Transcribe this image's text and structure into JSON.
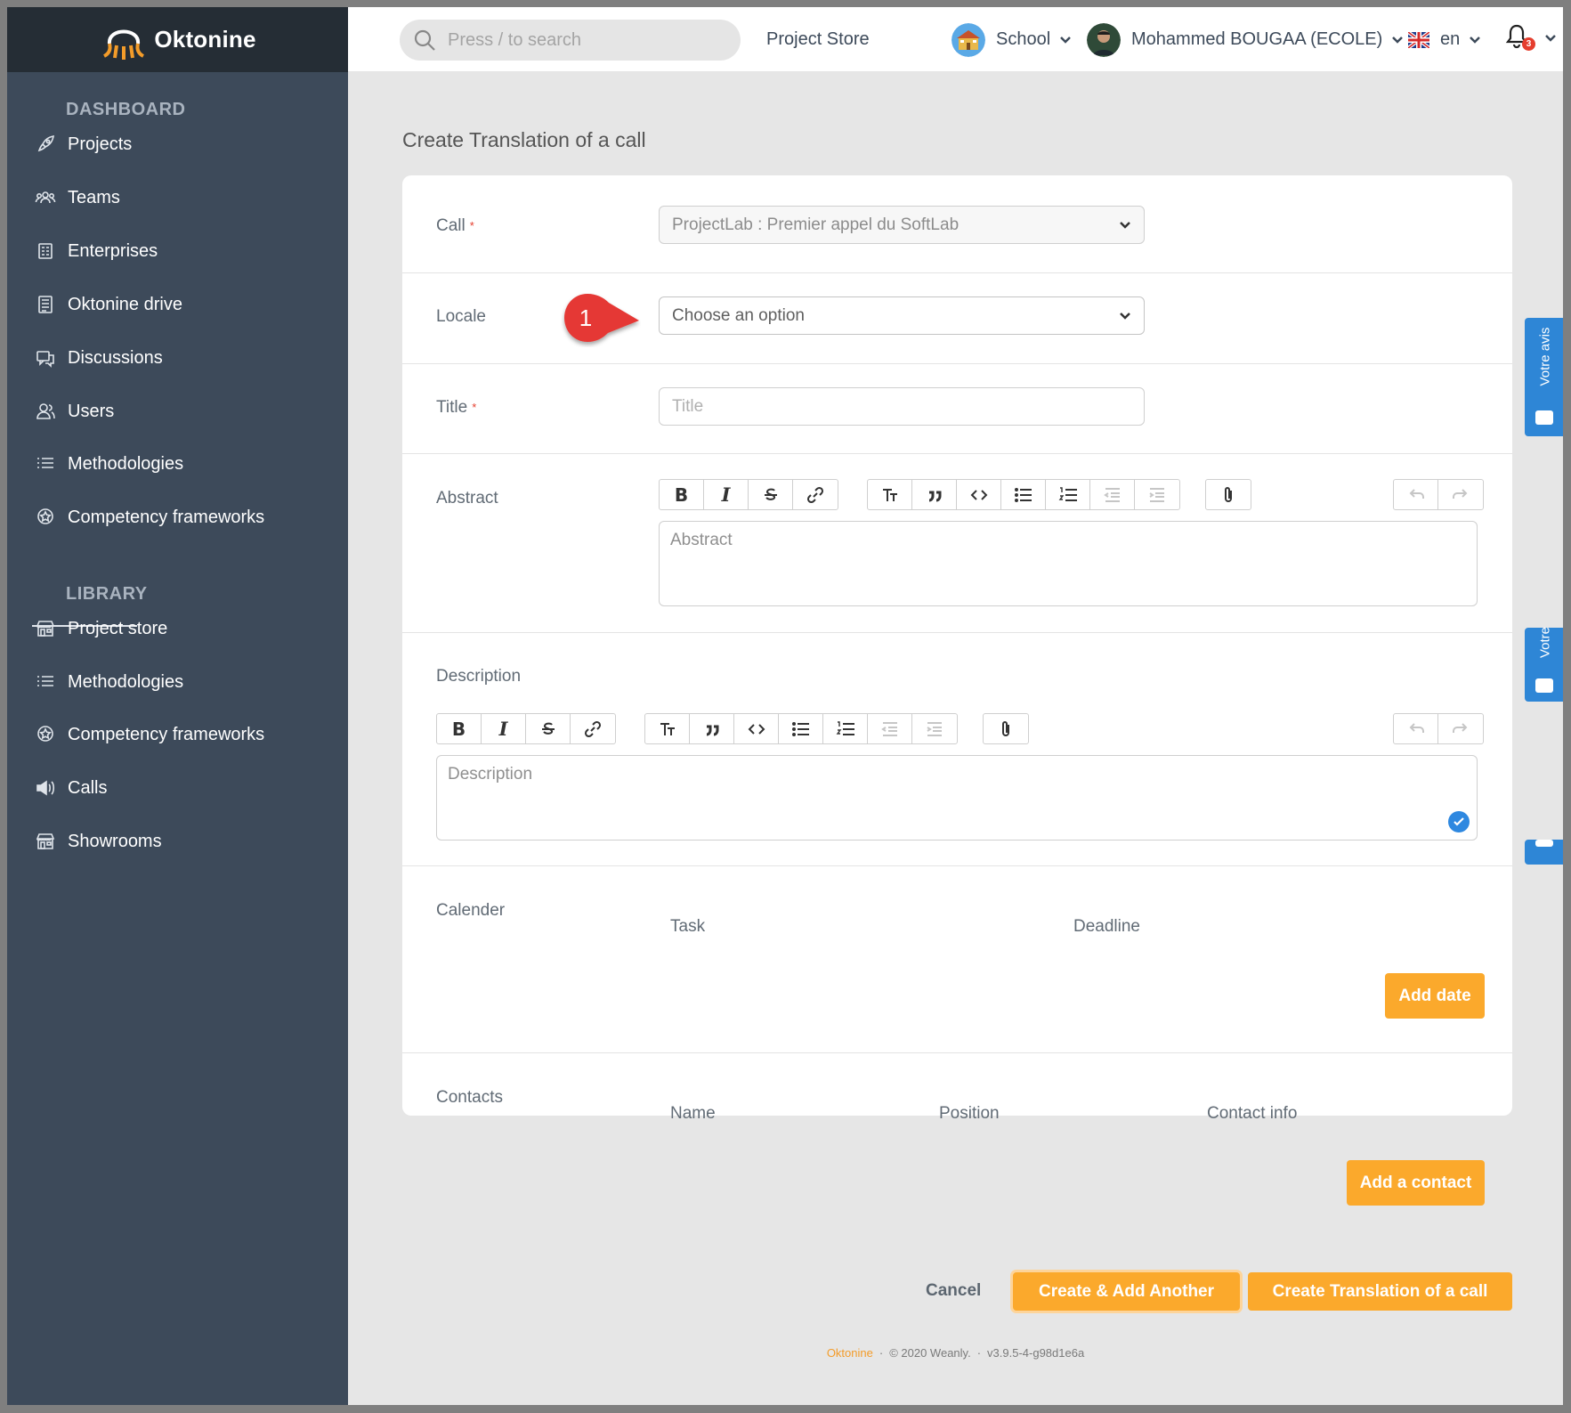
{
  "brand": {
    "name": "Oktonine"
  },
  "sidebar": {
    "dashboard_title": "DASHBOARD",
    "library_title": "LIBRARY",
    "dashboard_items": [
      {
        "label": "Projects",
        "icon": "rocket-icon"
      },
      {
        "label": "Teams",
        "icon": "team-icon"
      },
      {
        "label": "Enterprises",
        "icon": "building-icon"
      },
      {
        "label": "Oktonine drive",
        "icon": "drive-icon"
      },
      {
        "label": "Discussions",
        "icon": "chat-icon"
      },
      {
        "label": "Users",
        "icon": "users-icon"
      },
      {
        "label": "Methodologies",
        "icon": "list-icon"
      },
      {
        "label": "Competency frameworks",
        "icon": "badge-icon"
      }
    ],
    "library_items": [
      {
        "label": "Project store",
        "icon": "store-icon"
      },
      {
        "label": "Methodologies",
        "icon": "list-icon"
      },
      {
        "label": "Competency frameworks",
        "icon": "badge-icon"
      },
      {
        "label": "Calls",
        "icon": "megaphone-icon"
      },
      {
        "label": "Showrooms",
        "icon": "store-icon"
      }
    ]
  },
  "topbar": {
    "search_placeholder": "Press / to search",
    "project_store": "Project Store",
    "school": "School",
    "user_name": "Mohammed BOUGAA (ECOLE)",
    "language": "en",
    "notification_count": "3"
  },
  "page": {
    "title": "Create Translation of a call"
  },
  "form": {
    "call_label": "Call",
    "call_value": "ProjectLab : Premier appel du SoftLab",
    "locale_label": "Locale",
    "locale_placeholder": "Choose an option",
    "title_label": "Title",
    "title_placeholder": "Title",
    "abstract_label": "Abstract",
    "abstract_placeholder": "Abstract",
    "description_label": "Description",
    "description_placeholder": "Description",
    "calendar_label": "Calender",
    "calendar_cols": [
      "Task",
      "Deadline"
    ],
    "add_date": "Add date",
    "contacts_label": "Contacts",
    "contacts_cols": [
      "Name",
      "Position",
      "Contact info"
    ],
    "add_contact": "Add a contact",
    "required_mark": "*"
  },
  "toolbar_icons": [
    "bold-icon",
    "italic-icon",
    "strike-icon",
    "link-icon",
    "heading-icon",
    "quote-icon",
    "code-icon",
    "bullet-list-icon",
    "number-list-icon",
    "outdent-icon",
    "indent-icon",
    "attach-icon",
    "undo-icon",
    "redo-icon"
  ],
  "actions": {
    "cancel": "Cancel",
    "create_add_another": "Create & Add Another",
    "create": "Create Translation of a call"
  },
  "footer": {
    "brand": "Oktonine",
    "copyright": "© 2020 Weanly.",
    "version": "v3.9.5-4-g98d1e6a"
  },
  "feedback_tab": {
    "label": "Votre avis",
    "label_cut": "Votre"
  },
  "callout": {
    "step": "1"
  },
  "colors": {
    "sidebar": "#3d4a5a",
    "brand_bar": "#252d35",
    "accent": "#fba92c",
    "feedback": "#2e86d6",
    "callout": "#e53935"
  }
}
